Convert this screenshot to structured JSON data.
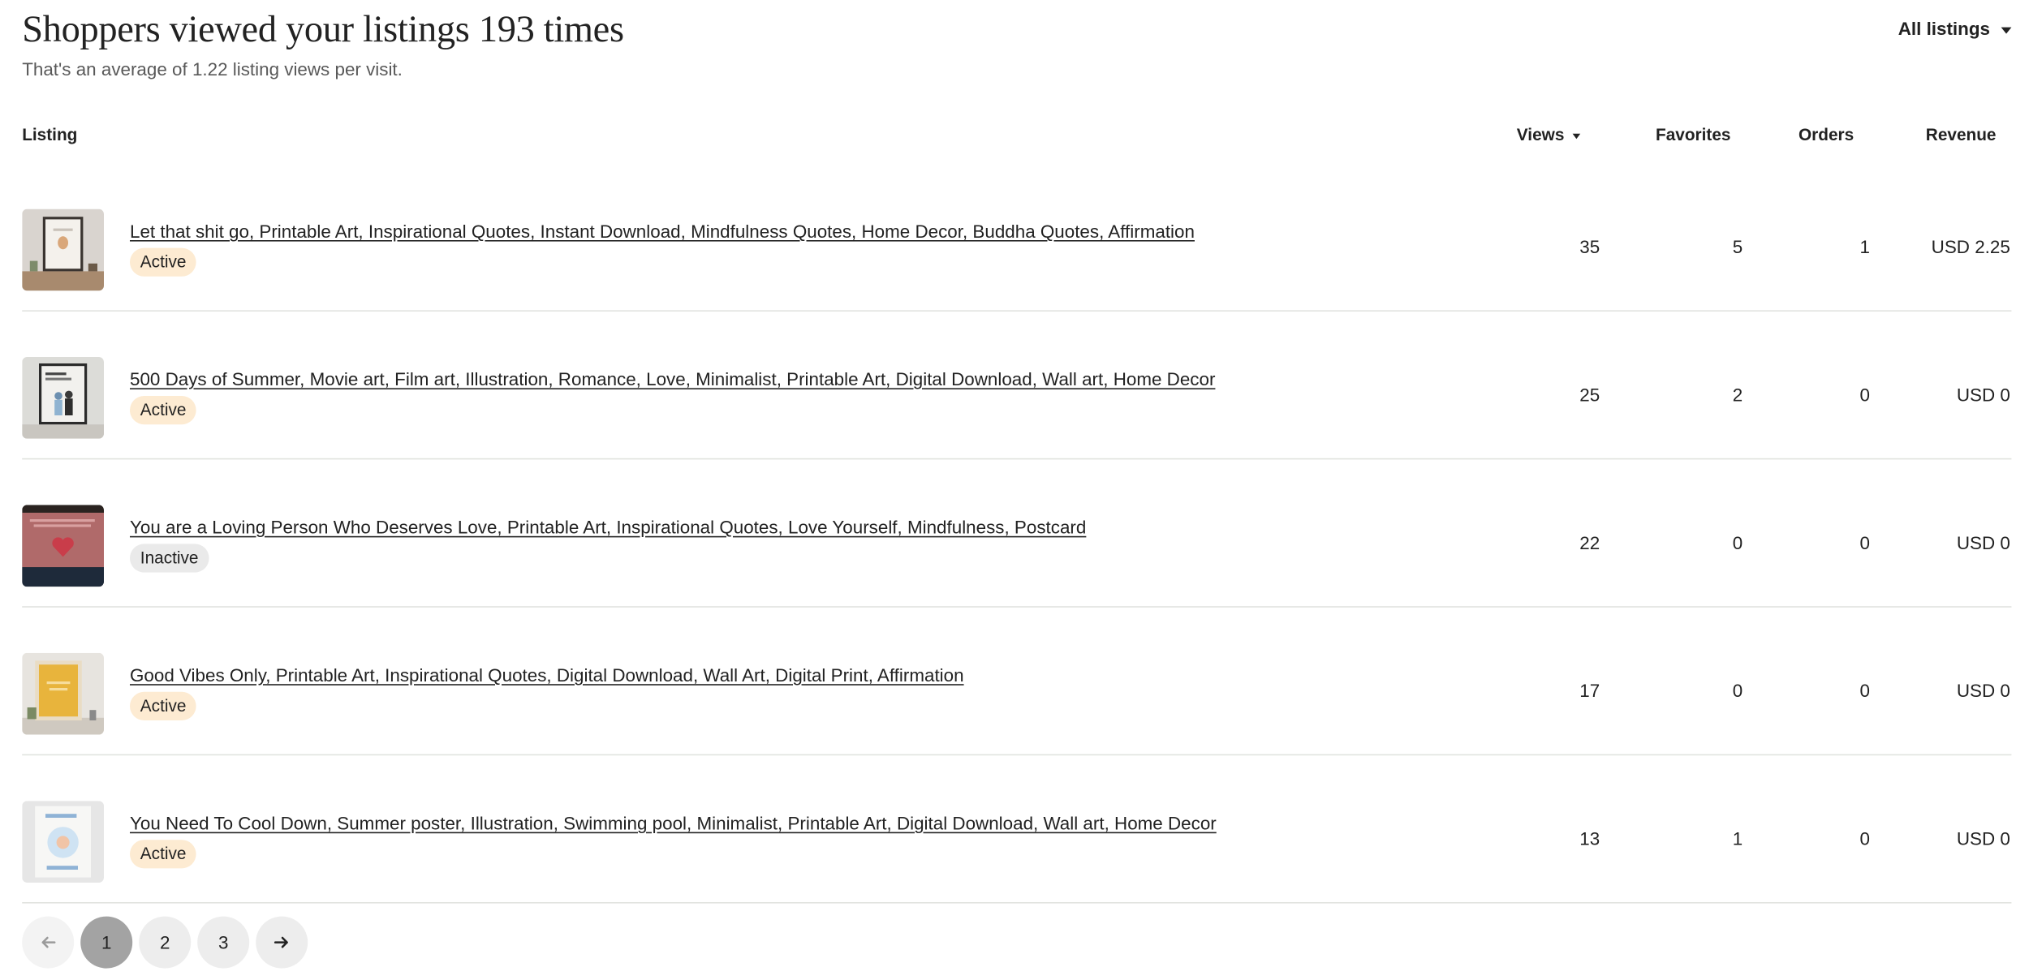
{
  "header": {
    "title": "Shoppers viewed your listings 193 times",
    "subtitle": "That's an average of 1.22 listing views per visit.",
    "filter_label": "All listings",
    "filter_icon": "chevron-down-icon"
  },
  "table": {
    "columns": {
      "listing": "Listing",
      "views": "Views",
      "favorites": "Favorites",
      "orders": "Orders",
      "revenue": "Revenue"
    },
    "rows": [
      {
        "title": "Let that shit go, Printable Art, Inspirational Quotes, Instant Download, Mindfulness Quotes, Home Decor, Buddha Quotes, Affirmation",
        "status": "Active",
        "views": "35",
        "favorites": "5",
        "orders": "1",
        "revenue": "USD 2.25"
      },
      {
        "title": "500 Days of Summer, Movie art, Film art, Illustration, Romance, Love, Minimalist, Printable Art, Digital Download, Wall art, Home Decor",
        "status": "Active",
        "views": "25",
        "favorites": "2",
        "orders": "0",
        "revenue": "USD 0"
      },
      {
        "title": "You are a Loving Person Who Deserves Love, Printable Art, Inspirational Quotes, Love Yourself, Mindfulness, Postcard",
        "status": "Inactive",
        "views": "22",
        "favorites": "0",
        "orders": "0",
        "revenue": "USD 0"
      },
      {
        "title": "Good Vibes Only, Printable Art, Inspirational Quotes, Digital Download, Wall Art, Digital Print, Affirmation",
        "status": "Active",
        "views": "17",
        "favorites": "0",
        "orders": "0",
        "revenue": "USD 0"
      },
      {
        "title": "You Need To Cool Down, Summer poster, Illustration, Swimming pool, Minimalist, Printable Art, Digital Download, Wall art, Home Decor",
        "status": "Active",
        "views": "13",
        "favorites": "1",
        "orders": "0",
        "revenue": "USD 0"
      }
    ]
  },
  "pagination": {
    "prev_icon": "arrow-left-icon",
    "pages": [
      "1",
      "2",
      "3"
    ],
    "current": "1",
    "next_icon": "arrow-right-icon"
  },
  "colors": {
    "active_badge": "#fdebd2",
    "inactive_badge": "#eaeaea",
    "current_page": "#a3a3a3"
  }
}
